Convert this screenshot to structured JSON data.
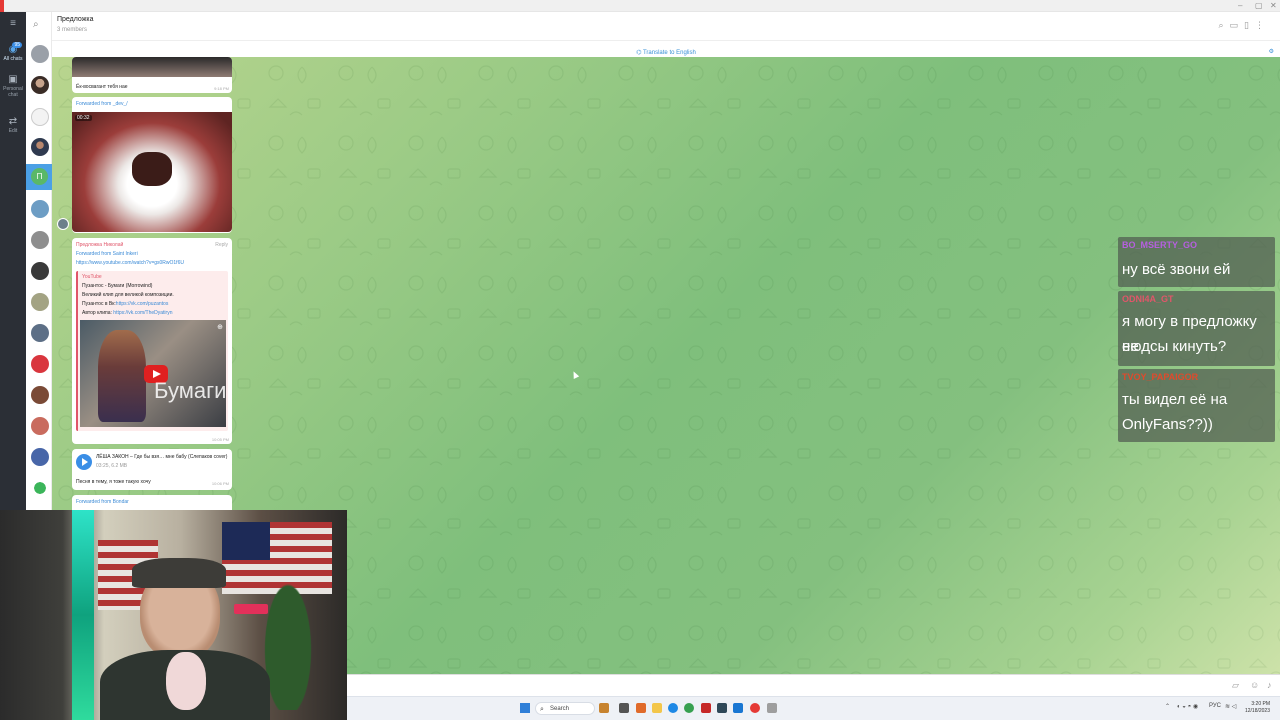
{
  "window": {
    "controls": [
      "–",
      "▢",
      "✕"
    ]
  },
  "folders": [
    {
      "label": "All chats",
      "icon": "chat-bubbles-icon",
      "badge": "95",
      "active": true
    },
    {
      "label": "Personal chat",
      "icon": "person-icon",
      "badge": "",
      "active": false
    },
    {
      "label": "Edit",
      "icon": "sliders-icon",
      "badge": "",
      "active": false
    }
  ],
  "chat": {
    "title": "Предложка",
    "subtitle": "3 members",
    "translate_label": "Translate to English"
  },
  "messages": {
    "m1_caption": "Ёк-восвагант тебя нае",
    "m1_time": "9:18 PM",
    "m2_forward": "Forwarded from",
    "m2_forward_name": "_dev_/",
    "m2_duration": "00:32",
    "m3_sender": "Предложка Николай",
    "m3_reply": "Reply",
    "m3_forward": "Forwarded from Saint Inkeri",
    "m3_link": "https://www.youtube.com/watch?v=gs0RwO1f6U",
    "m3_yt_site": "YouTube",
    "m3_yt_title": "Пузантос - Бумаги (Morrowind)",
    "m3_yt_l1": "Великий клип для великой композиции.",
    "m3_yt_l2_prefix": "Пузантос в Вк:",
    "m3_yt_l2_link": "https://vk.com/puzantos",
    "m3_yt_l3_prefix": "Автор клипа:",
    "m3_yt_l3_link": "https://vk.com/TheDyatiryn",
    "m3_thumb_text": "Бумаги",
    "m3_time": "10:05 PM",
    "m4_title": "ЛЁША ЗАКОН – Где бы взя… мне бабу (Слепаков cover)",
    "m4_meta": "03:25, 6.2 MB",
    "m4_text": "Песня в тему, я тоже такую хочу",
    "m4_time": "10:06 PM",
    "m5_forward": "Forwarded from Bondar"
  },
  "overlay": [
    {
      "nick": "BO_MSERTY_GO",
      "nick_color": "#b65fe0",
      "lines": [
        "ну всё звони ей"
      ]
    },
    {
      "nick": "ODNI4A_GT",
      "nick_color": "#e0566a",
      "lines": [
        "я могу в предложку ее",
        "нюдсы кинуть?"
      ]
    },
    {
      "nick": "TVOY_PAPAIGOR",
      "nick_color": "#e04a2c",
      "lines": [
        "ты видел её на",
        "OnlyFans??))"
      ]
    }
  ],
  "taskbar": {
    "search_label": "Search",
    "lang": "РУС",
    "time": "3:20 PM",
    "date": "12/18/2023"
  },
  "colors": {
    "accent": "#3a8ee6",
    "folders_bg": "#2b2f36",
    "wallpaper_mid": "#7fbf7c",
    "overlay_bg": "rgba(80,92,80,0.72)"
  }
}
